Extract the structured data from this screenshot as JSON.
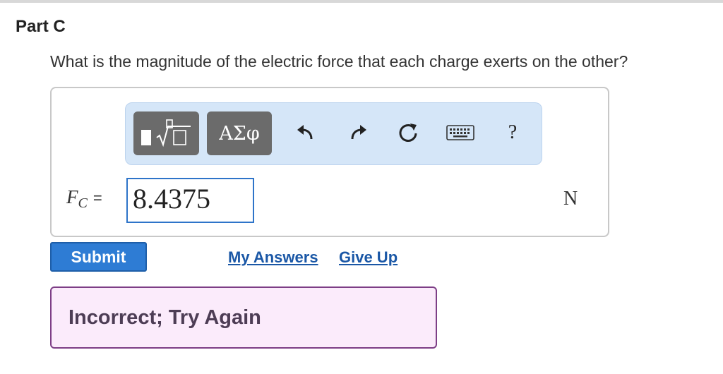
{
  "part": {
    "title": "Part C"
  },
  "question": {
    "text": "What is the magnitude of the electric force that each charge exerts on the other?"
  },
  "toolbar": {
    "templates_icon": "templates-sqrt-icon",
    "greek_label": "ΑΣφ",
    "undo_icon": "undo-arrow-icon",
    "redo_icon": "redo-arrow-icon",
    "reset_icon": "reset-icon",
    "keyboard_icon": "keyboard-icon",
    "help_label": "?"
  },
  "answer": {
    "variable": "F",
    "subscript": "C",
    "equals": "=",
    "value": "8.4375",
    "unit": "N"
  },
  "actions": {
    "submit_label": "Submit",
    "my_answers_label": "My Answers",
    "give_up_label": "Give Up"
  },
  "feedback": {
    "text": "Incorrect; Try Again",
    "colors": {
      "background": "#fbebfb",
      "border": "#7d3e86"
    }
  },
  "colors": {
    "accent": "#2e7cd4",
    "link": "#1a57a6",
    "toolbar_bg": "#d5e6f8",
    "tool_button": "#6b6b6b"
  }
}
